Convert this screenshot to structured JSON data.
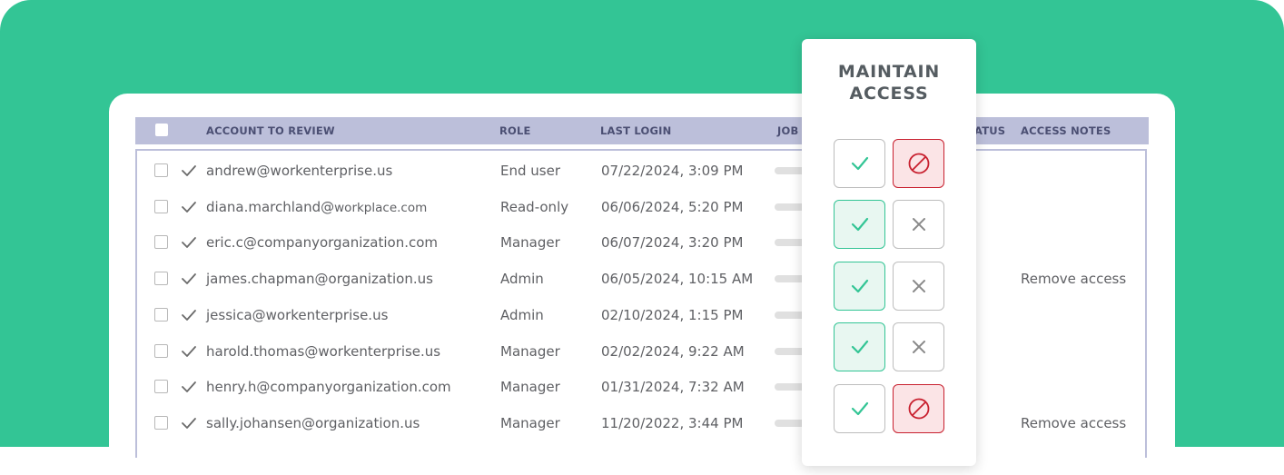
{
  "colors": {
    "background": "#33c595",
    "header": "#bcbfda",
    "approve": "#33c595",
    "deny": "#c8202f"
  },
  "table": {
    "columns": {
      "account": "ACCOUNT TO REVIEW",
      "role": "ROLE",
      "last_login": "LAST LOGIN",
      "job": "JOB T",
      "status": "ATUS",
      "notes": "ACCESS NOTES"
    },
    "rows": [
      {
        "account": "andrew@workenterprise.us",
        "account_suffix": "",
        "role": "End user",
        "last_login": "07/22/2024, 3:09 PM",
        "note": "",
        "decision": "deny"
      },
      {
        "account": "diana.marchland@",
        "account_suffix": "workplace.com",
        "role": "Read-only",
        "last_login": "06/06/2024, 5:20 PM",
        "note": "",
        "decision": "approve"
      },
      {
        "account": "eric.c@companyorganization.com",
        "account_suffix": "",
        "role": "Manager",
        "last_login": "06/07/2024, 3:20 PM",
        "note": "",
        "decision": "approve"
      },
      {
        "account": "james.chapman@organization.us",
        "account_suffix": "",
        "role": "Admin",
        "last_login": "06/05/2024, 10:15 AM",
        "note": "Remove access",
        "decision": "approve"
      },
      {
        "account": "jessica@workenterprise.us",
        "account_suffix": "",
        "role": "Admin",
        "last_login": "02/10/2024, 1:15 PM",
        "note": "",
        "decision": "deny"
      },
      {
        "account": "harold.thomas@workenterprise.us",
        "account_suffix": "",
        "role": "Manager",
        "last_login": "02/02/2024, 9:22 AM",
        "note": "",
        "decision": ""
      },
      {
        "account": "henry.h@companyorganization.com",
        "account_suffix": "",
        "role": "Manager",
        "last_login": "01/31/2024, 7:32 AM",
        "note": "",
        "decision": ""
      },
      {
        "account": "sally.johansen@organization.us",
        "account_suffix": "",
        "role": "Manager",
        "last_login": "11/20/2022, 3:44 PM",
        "note": "Remove access",
        "decision": ""
      }
    ]
  },
  "popup": {
    "title_line1": "MAINTAIN",
    "title_line2": "ACCESS",
    "buttons": [
      {
        "approve_icon": "check-icon",
        "deny_icon": "no-entry-icon",
        "state": "deny"
      },
      {
        "approve_icon": "check-icon",
        "deny_icon": "x-icon",
        "state": "approve"
      },
      {
        "approve_icon": "check-icon",
        "deny_icon": "x-icon",
        "state": "approve"
      },
      {
        "approve_icon": "check-icon",
        "deny_icon": "x-icon",
        "state": "approve"
      },
      {
        "approve_icon": "check-icon",
        "deny_icon": "no-entry-icon",
        "state": "deny"
      }
    ]
  }
}
